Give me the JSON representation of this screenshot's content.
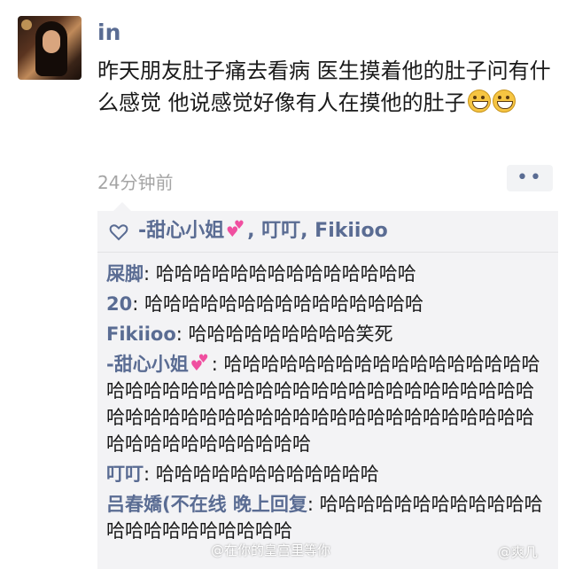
{
  "post": {
    "username": "in",
    "text": "昨天朋友肚子痛去看病 医生摸着他的肚子问有什么感觉 他说感觉好像有人在摸他的肚子",
    "emoji": "grinning-face",
    "timestamp": "24分钟前",
    "more_label": "••"
  },
  "likes": {
    "icon": "heart-outline-icon",
    "names_before": "-甜心小姐",
    "names_after": ", 叮叮, Fikiioo"
  },
  "comments": [
    {
      "author": "屎脚",
      "text": ": 哈哈哈哈哈哈哈哈哈哈哈哈哈哈"
    },
    {
      "author": "20",
      "text": ": 哈哈哈哈哈哈哈哈哈哈哈哈哈哈哈"
    },
    {
      "author": "Fikiioo",
      "text": ": 哈哈哈哈哈哈哈哈哈笑死"
    },
    {
      "author": "-甜心小姐",
      "text": ": 哈哈哈哈哈哈哈哈哈哈哈哈哈哈哈哈哈哈哈哈哈哈哈哈哈哈哈哈哈哈哈哈哈哈哈哈哈哈哈哈哈哈哈哈哈哈哈哈哈哈哈哈哈哈哈哈哈哈哈哈哈哈哈哈哈哈哈哈哈哈哈哈哈哈"
    },
    {
      "author": "叮叮",
      "text": ": 哈哈哈哈哈哈哈哈哈哈哈哈"
    },
    {
      "author": "吕春嬌(不在线 晚上回复",
      "text": ": 哈哈哈哈哈哈哈哈哈哈哈哈哈哈哈哈哈哈哈哈哈哈"
    }
  ],
  "watermark": {
    "left": "@在你的皇宫里等你",
    "right": "@爽几"
  },
  "colors": {
    "author": "#5a6c93",
    "timestamp": "#a5a5a5",
    "comment_bg": "#f3f3f5"
  }
}
